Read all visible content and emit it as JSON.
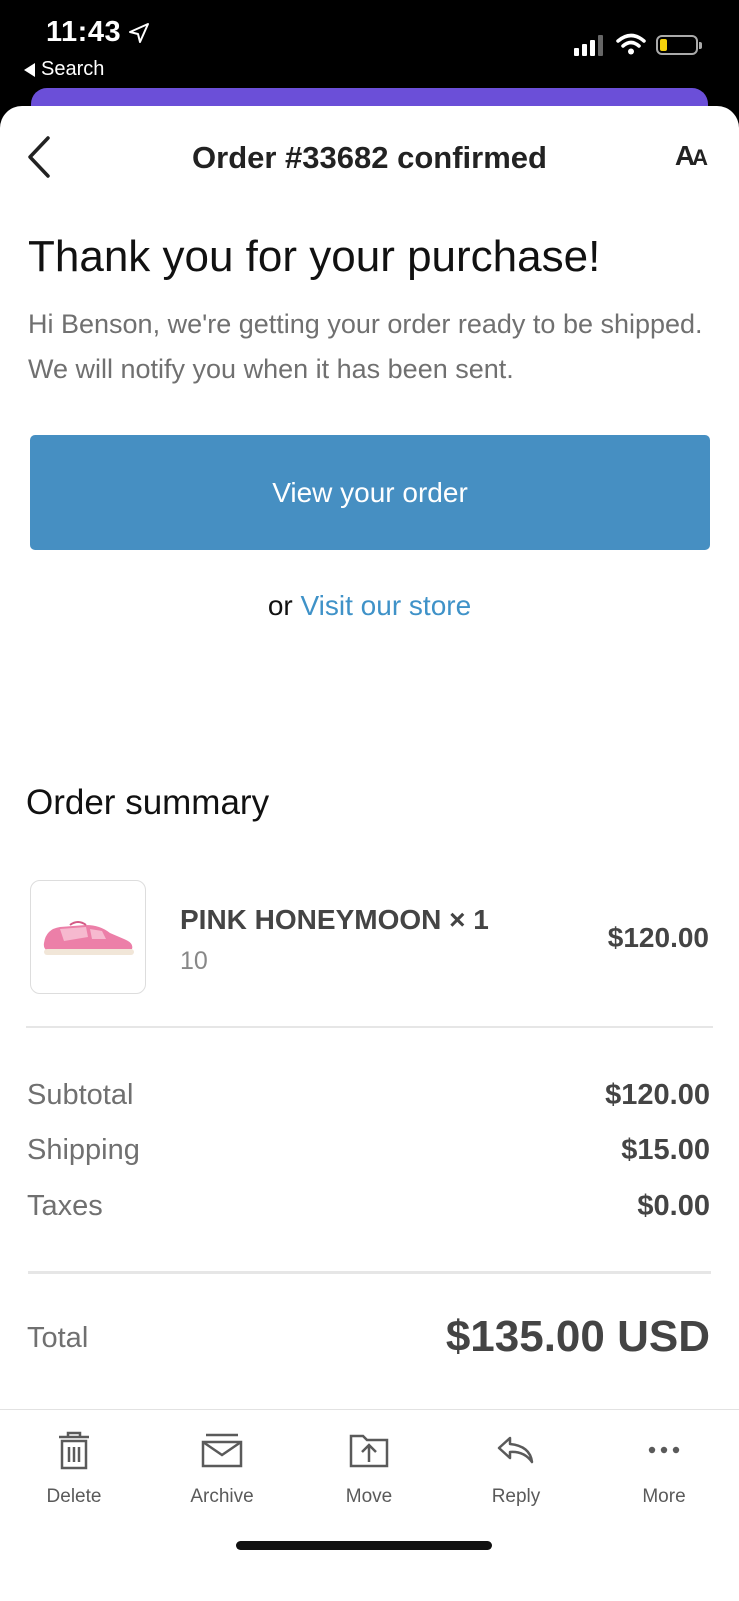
{
  "status_bar": {
    "time": "11:43",
    "back_label": "Search",
    "icons": [
      "location-arrow-icon",
      "signal-icon",
      "wifi-icon",
      "battery-icon"
    ]
  },
  "nav": {
    "title": "Order #33682 confirmed",
    "back_icon": "chevron-left-icon",
    "text_size_icon": "AA"
  },
  "message": {
    "headline": "Thank you for your purchase!",
    "body": "Hi Benson, we're getting your order ready to be shipped. We will notify you when it has been sent.",
    "cta_label": "View your order",
    "or_text": "or",
    "store_link": "Visit our store"
  },
  "summary": {
    "title": "Order summary",
    "items": [
      {
        "name": "PINK HONEYMOON × 1",
        "variant": "10",
        "price": "$120.00",
        "image": "pink-sneaker-image"
      }
    ],
    "rows": [
      {
        "label": "Subtotal",
        "value": "$120.00"
      },
      {
        "label": "Shipping",
        "value": "$15.00"
      },
      {
        "label": "Taxes",
        "value": "$0.00"
      }
    ],
    "total_label": "Total",
    "total_value": "$135.00 USD"
  },
  "toolbar": {
    "items": [
      {
        "label": "Delete",
        "icon": "trash-icon"
      },
      {
        "label": "Archive",
        "icon": "archive-icon"
      },
      {
        "label": "Move",
        "icon": "move-icon"
      },
      {
        "label": "Reply",
        "icon": "reply-icon"
      },
      {
        "label": "More",
        "icon": "more-icon"
      }
    ]
  },
  "colors": {
    "accent": "#468fc2",
    "link": "#3f92c8",
    "purple_header": "#6b4fd8",
    "battery_fill": "#f5d10b"
  }
}
